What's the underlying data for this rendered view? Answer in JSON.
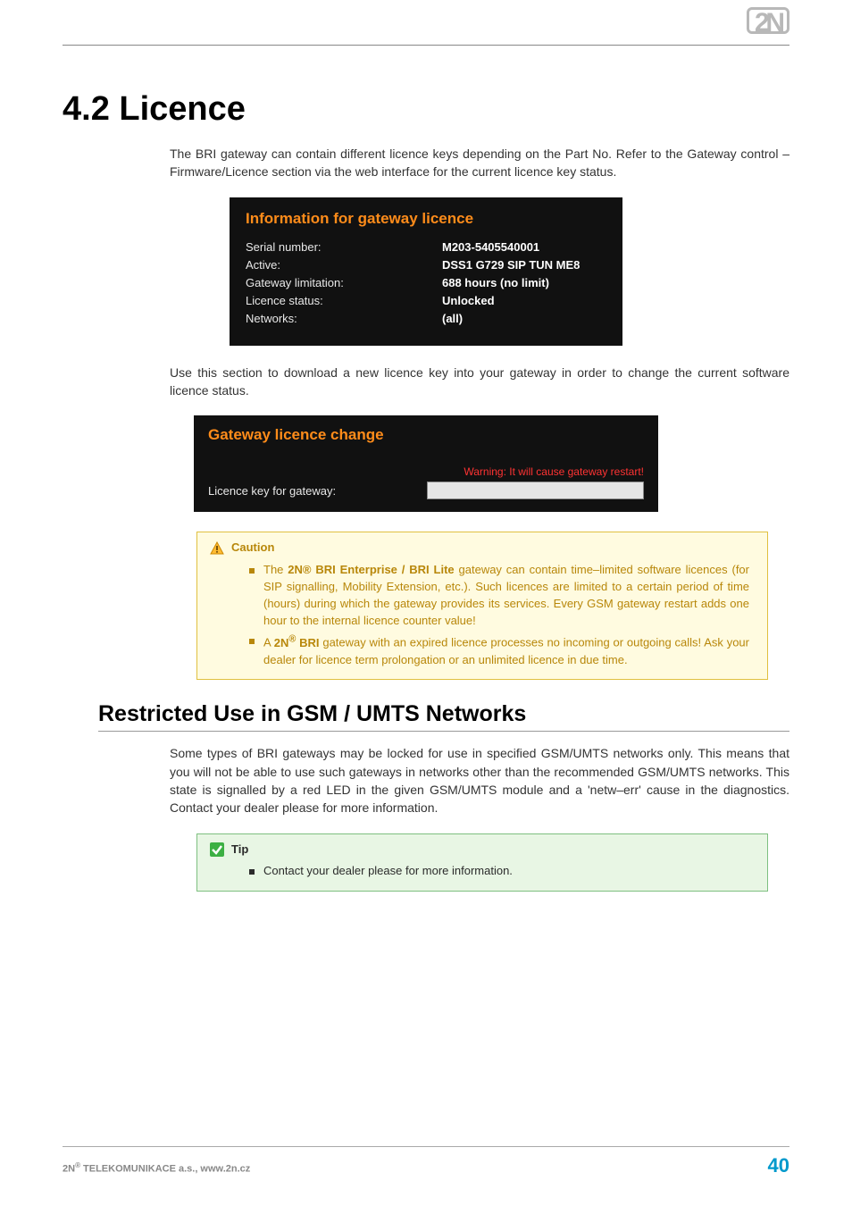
{
  "logo": "2N",
  "section_title": "4.2 Licence",
  "intro_para": "The BRI gateway can contain different licence keys depending on the Part No. Refer to the Gateway control – Firmware/Licence section via the web interface for the current licence key status.",
  "info_panel": {
    "title": "Information for gateway licence",
    "rows": [
      {
        "label": "Serial number:",
        "value": "M203-5405540001"
      },
      {
        "label": "Active:",
        "value": "DSS1 G729 SIP TUN ME8"
      },
      {
        "label": "Gateway limitation:",
        "value": "688 hours (no limit)"
      },
      {
        "label": "Licence status:",
        "value": "Unlocked"
      },
      {
        "label": "Networks:",
        "value": "(all)"
      }
    ]
  },
  "para2": "Use this section to download a new licence key into your gateway in order to change the current software licence status.",
  "change_panel": {
    "title": "Gateway licence change",
    "warning": "Warning: It will cause gateway restart!",
    "field_label": "Licence key for gateway:",
    "field_value": ""
  },
  "caution": {
    "title": "Caution",
    "item1_pre": "The ",
    "item1_bold": "2N® BRI Enterprise / BRI Lite",
    "item1_post": " gateway can contain time–limited software licences (for SIP signalling, Mobility Extension, etc.). Such licences are limited to a certain period of time (hours) during which the gateway provides its services. Every GSM gateway restart adds one hour to the internal licence counter value!",
    "item2_pre": "A ",
    "item2_bold": "2N",
    "item2_sup": "®",
    "item2_bold2": " BRI",
    "item2_post": " gateway with an expired licence processes no incoming or outgoing calls! Ask your dealer for licence term prolongation or an unlimited licence in due time."
  },
  "subsection_title": "Restricted Use in GSM / UMTS Networks",
  "para3": "Some types of BRI gateways may be locked for use in specified GSM/UMTS networks only. This means that you will not be able to use such gateways in networks other than the recommended GSM/UMTS networks. This state is signalled by a red LED in the given GSM/UMTS module and a 'netw–err' cause in the diagnostics. Contact your dealer please for more information.",
  "tip": {
    "title": "Tip",
    "item1": "Contact your dealer please for more information."
  },
  "footer": {
    "left_pre": "2N",
    "left_sup": "®",
    "left_post": " TELEKOMUNIKACE a.s., www.2n.cz",
    "page_no": "40"
  }
}
